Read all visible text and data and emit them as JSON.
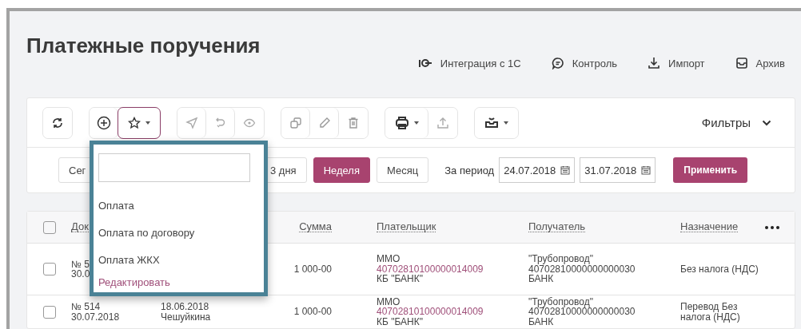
{
  "page": {
    "title": "Платежные поручения"
  },
  "actions": [
    {
      "label": "Интеграция с 1С"
    },
    {
      "label": "Контроль"
    },
    {
      "label": "Импорт"
    },
    {
      "label": "Архив"
    }
  ],
  "toolbar": {
    "favorites_open": true,
    "filters_label": "Фильтры"
  },
  "period": {
    "buttons": [
      {
        "label": "Сег",
        "selected": false
      },
      {
        "label": "3 дня",
        "selected": false
      },
      {
        "label": "Неделя",
        "selected": true
      },
      {
        "label": "Месяц",
        "selected": false
      }
    ],
    "range_label": "За период",
    "date_from": "24.07.2018",
    "date_to": "31.07.2018",
    "apply": "Применить"
  },
  "favorites_menu": {
    "items": [
      "Оплата",
      "Оплата по договору",
      "Оплата ЖКХ"
    ],
    "edit_link": "Редактировать"
  },
  "table": {
    "all_checked": false,
    "columns": [
      {
        "label": "Док"
      },
      {
        "label": "Сумма"
      },
      {
        "label": "Плательщик"
      },
      {
        "label": "Получатель"
      },
      {
        "label": "Назначение"
      }
    ],
    "rows": [
      {
        "checked": false,
        "doc": [
          "№ 5",
          "30.0"
        ],
        "sum": "1 000-00",
        "payer": {
          "name": "ММО",
          "account": "40702810100000014009",
          "bank": "КБ \"БАНК\""
        },
        "receiver": [
          "\"Трубопровод\"",
          "40702810000000000030",
          "БАНК"
        ],
        "purpose": "Без налога (НДС)"
      },
      {
        "checked": false,
        "doc": [
          "№ 514",
          "30.07.2018"
        ],
        "status": [
          "18.06.2018",
          "Чешуйкина"
        ],
        "sum": "1 000-00",
        "payer": {
          "name": "ММО",
          "account": "40702810100000014009",
          "bank": "КБ \"БАНК\""
        },
        "receiver": [
          "\"Трубопровод\"",
          "40702810000000000030",
          "БАНК"
        ],
        "purpose": "Перевод Без налога (НДС)"
      }
    ]
  }
}
